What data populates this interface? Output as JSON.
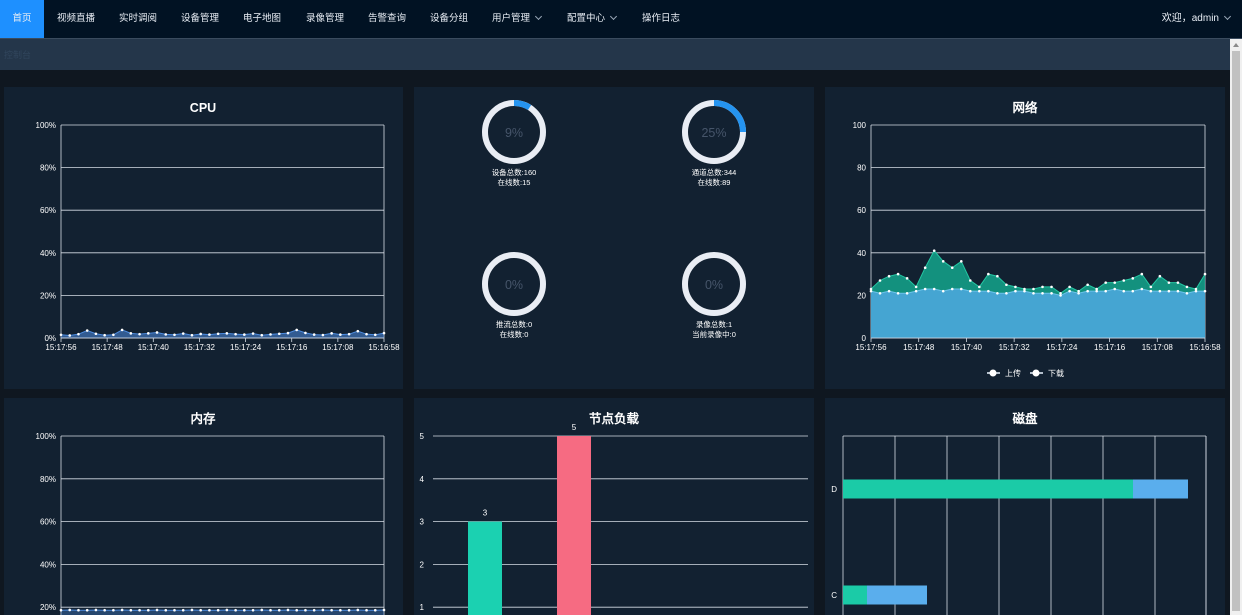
{
  "nav": {
    "items": [
      {
        "label": "首页",
        "active": true
      },
      {
        "label": "视频直播"
      },
      {
        "label": "实时调阅"
      },
      {
        "label": "设备管理"
      },
      {
        "label": "电子地图"
      },
      {
        "label": "录像管理"
      },
      {
        "label": "告警查询"
      },
      {
        "label": "设备分组"
      },
      {
        "label": "用户管理",
        "dropdown": true
      },
      {
        "label": "配置中心",
        "dropdown": true
      },
      {
        "label": "操作日志"
      }
    ],
    "welcome": "欢迎，admin"
  },
  "breadcrumb": "控制台",
  "colors": {
    "accent": "#1e90ff",
    "cpu_line": "#4d8ce0",
    "net_upload": "#14a58c",
    "net_download": "#45a5d2",
    "bar_green": "#1bd1b1",
    "bar_red": "#f66b82",
    "disk_used": "#1bcba7",
    "disk_free": "#5aaeed",
    "gauge_ring": "#e9edf4",
    "gauge_arc": "#2594f0"
  },
  "gauges": [
    {
      "percent_label": "9%",
      "value": 0.09,
      "line1": "设备总数:160",
      "line2": "在线数:15"
    },
    {
      "percent_label": "25%",
      "value": 0.25,
      "line1": "通道总数:344",
      "line2": "在线数:89"
    },
    {
      "percent_label": "0%",
      "value": 0,
      "line1": "推流总数:0",
      "line2": "在线数:0"
    },
    {
      "percent_label": "0%",
      "value": 0,
      "line1": "录像总数:1",
      "line2": "当前录像中:0"
    }
  ],
  "chart_data": [
    {
      "id": "cpu",
      "type": "area",
      "title": "CPU",
      "x_ticks": [
        "15:17:56",
        "15:17:48",
        "15:17:40",
        "15:17:32",
        "15:17:24",
        "15:17:16",
        "15:17:08",
        "15:16:58"
      ],
      "y_ticks": [
        "0%",
        "20%",
        "40%",
        "60%",
        "80%",
        "100%"
      ],
      "ylim": [
        0,
        100
      ],
      "grid": true,
      "series": [
        {
          "values": [
            1.5,
            1.2,
            1.8,
            3.5,
            2,
            1.3,
            1.5,
            3.8,
            2.2,
            1.8,
            2.2,
            2.6,
            1.7,
            1.5,
            2.1,
            1.3,
            1.9,
            1.6,
            2,
            2.2,
            1.8,
            1.6,
            2.1,
            1.3,
            1.7,
            2,
            2.3,
            3.8,
            2.4,
            1.6,
            1.4,
            2.2,
            1.6,
            1.8,
            3.2,
            1.8,
            1.5,
            2.3
          ]
        }
      ]
    },
    {
      "id": "network",
      "type": "area",
      "title": "网络",
      "x_ticks": [
        "15:17:56",
        "15:17:48",
        "15:17:40",
        "15:17:32",
        "15:17:24",
        "15:17:16",
        "15:17:08",
        "15:16:58"
      ],
      "y_ticks": [
        "0",
        "20",
        "40",
        "60",
        "80",
        "100"
      ],
      "ylim": [
        0,
        100
      ],
      "grid": true,
      "legend_position": "bottom-center",
      "series": [
        {
          "name": "上传",
          "values": [
            23,
            27,
            29,
            30,
            28,
            24,
            33,
            41,
            36,
            33,
            36,
            27,
            24,
            30,
            29,
            25,
            24,
            23,
            23,
            24,
            24,
            21,
            24,
            22,
            25,
            23,
            26,
            26,
            27,
            28,
            30,
            24,
            29,
            26,
            26,
            24,
            23,
            30
          ]
        },
        {
          "name": "下载",
          "values": [
            22,
            21,
            22,
            21,
            21,
            22,
            23,
            23,
            22,
            23,
            23,
            22,
            22,
            22,
            21,
            21,
            22,
            22,
            21,
            21,
            21,
            20,
            22,
            21,
            22,
            22,
            22,
            23,
            22,
            22,
            23,
            22,
            22,
            22,
            22,
            21,
            22,
            22
          ]
        }
      ]
    },
    {
      "id": "memory",
      "type": "area",
      "title": "内存",
      "y_ticks": [
        "20%",
        "40%",
        "60%",
        "80%",
        "100%"
      ],
      "ylim": [
        0,
        100
      ],
      "grid": true,
      "series": [
        {
          "values": [
            18.6,
            18.7,
            18.6,
            18.6,
            18.7,
            18.6,
            18.6,
            18.7,
            18.6,
            18.6,
            18.6,
            18.7,
            18.6,
            18.6,
            18.6,
            18.7,
            18.6,
            18.6,
            18.6,
            18.7,
            18.6,
            18.6,
            18.6,
            18.7,
            18.6,
            18.6,
            18.7,
            18.6,
            18.6,
            18.6,
            18.7,
            18.6,
            18.6,
            18.6,
            18.7,
            18.6,
            18.6,
            18.7
          ]
        }
      ]
    },
    {
      "id": "node_load",
      "type": "bar",
      "title": "节点负载",
      "y_ticks": [
        "1",
        "2",
        "3",
        "4",
        "5"
      ],
      "ylim": [
        0,
        5
      ],
      "grid": true,
      "values": [
        3,
        5
      ],
      "value_labels": [
        "3",
        "5"
      ]
    },
    {
      "id": "disk",
      "type": "bar",
      "orientation": "horizontal",
      "stacked": true,
      "title": "磁盘",
      "categories": [
        "D",
        "C"
      ],
      "grid": true,
      "series": [
        {
          "values": [
            290,
            24
          ]
        },
        {
          "values": [
            55,
            60
          ]
        }
      ]
    }
  ]
}
